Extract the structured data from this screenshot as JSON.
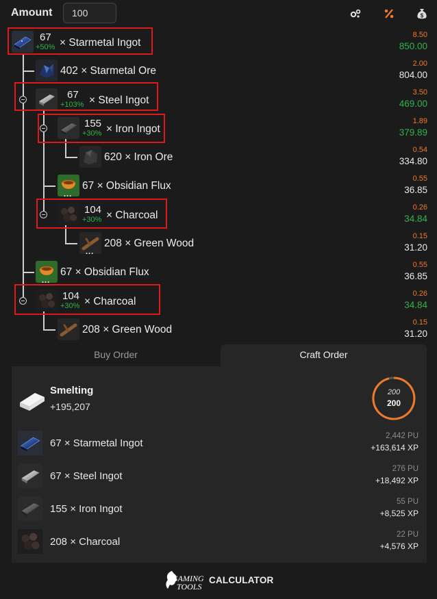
{
  "header": {
    "amount_label": "Amount",
    "amount_value": "100",
    "tools": [
      {
        "name": "settings-gears-icon",
        "color": "#dddddd"
      },
      {
        "name": "percent-icon",
        "color": "#f07a2a"
      },
      {
        "name": "money-bag-icon",
        "color": "#dddddd"
      }
    ]
  },
  "tree": [
    {
      "qty": "67",
      "pct": "+50%",
      "name": "× Starmetal Ingot",
      "unit": "8.50",
      "total": "850.00",
      "total_green": true,
      "highlight": true,
      "collapsible": false
    },
    {
      "qty": "402",
      "name": "× Starmetal Ore",
      "unit": "2.00",
      "total": "804.00",
      "total_green": false
    },
    {
      "qty": "67",
      "pct": "+103%",
      "name": "× Steel Ingot",
      "unit": "3.50",
      "total": "469.00",
      "total_green": true,
      "highlight": true,
      "collapsible": true
    },
    {
      "qty": "155",
      "pct": "+30%",
      "name": "× Iron Ingot",
      "unit": "1.89",
      "total": "379.89",
      "total_green": true,
      "highlight": true,
      "collapsible": true
    },
    {
      "qty": "620",
      "name": "× Iron Ore",
      "unit": "0.54",
      "total": "334.80",
      "total_green": false
    },
    {
      "qty": "67",
      "name": "× Obsidian Flux",
      "unit": "0.55",
      "total": "36.85",
      "total_green": false
    },
    {
      "qty": "104",
      "pct": "+30%",
      "name": "× Charcoal",
      "unit": "0.26",
      "total": "34.84",
      "total_green": true,
      "highlight": true,
      "collapsible": true
    },
    {
      "qty": "208",
      "name": "× Green Wood",
      "unit": "0.15",
      "total": "31.20",
      "total_green": false
    },
    {
      "qty": "67",
      "name": "× Obsidian Flux",
      "unit": "0.55",
      "total": "36.85",
      "total_green": false
    },
    {
      "qty": "104",
      "pct": "+30%",
      "name": "× Charcoal",
      "unit": "0.26",
      "total": "34.84",
      "total_green": true,
      "highlight": true,
      "collapsible": true
    },
    {
      "qty": "208",
      "name": "× Green Wood",
      "unit": "0.15",
      "total": "31.20",
      "total_green": false
    }
  ],
  "more_dots": "...",
  "tabs": {
    "buy_order": "Buy Order",
    "craft_order": "Craft Order"
  },
  "craft": {
    "skill": "Smelting",
    "xp_total": "+195,207",
    "level_current": "200",
    "level_target": "200",
    "items": [
      {
        "name": "67 × Starmetal Ingot",
        "pu": "2,442 PU",
        "xp": "+163,614 XP"
      },
      {
        "name": "67 × Steel Ingot",
        "pu": "276 PU",
        "xp": "+18,492 XP"
      },
      {
        "name": "155 × Iron Ingot",
        "pu": "55 PU",
        "xp": "+8,525 XP"
      },
      {
        "name": "208 × Charcoal",
        "pu": "22 PU",
        "xp": "+4,576 XP"
      }
    ]
  },
  "footer": {
    "logo_line1": "GAMING",
    "logo_line2": "TOOLS",
    "label": "CALCULATOR"
  },
  "colors": {
    "accent_orange": "#f07a2a",
    "positive_green": "#2fb34c",
    "highlight_red": "#e01a1a"
  }
}
